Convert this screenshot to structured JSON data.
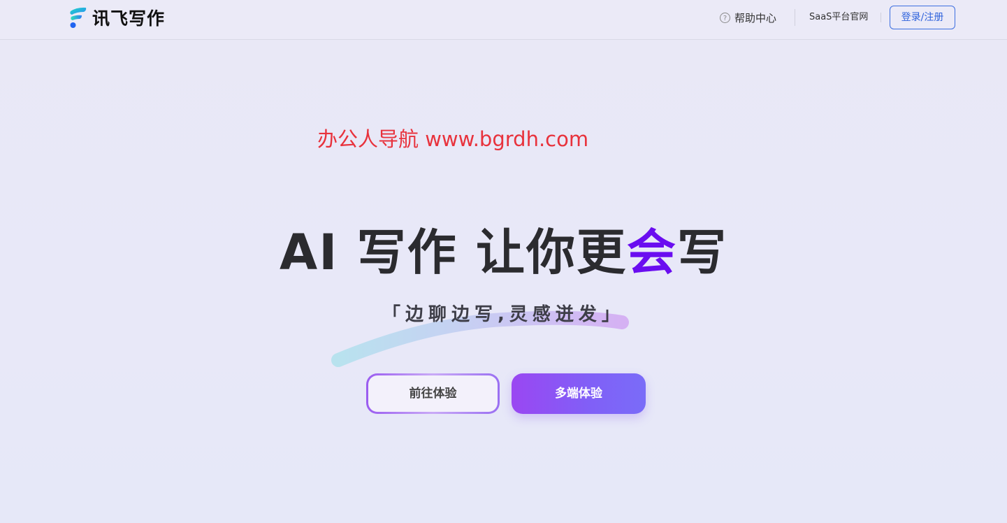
{
  "header": {
    "logo_text": "讯飞写作",
    "help_icon_glyph": "?",
    "help_label": "帮助中心",
    "saas_label": "SaaS平台官网",
    "login_label": "登录/注册"
  },
  "watermark": {
    "text": "办公人导航 www.bgrdh.com"
  },
  "hero": {
    "title_pre": "AI 写作 让你更",
    "title_accent": "会",
    "title_post": "写",
    "subtitle": "「边聊边写,灵感迸发」",
    "try_button": "前往体验",
    "multi_button": "多端体验"
  },
  "colors": {
    "accent": "#6a0df0",
    "login_blue": "#2f63dc",
    "watermark_red": "#e8323c"
  }
}
